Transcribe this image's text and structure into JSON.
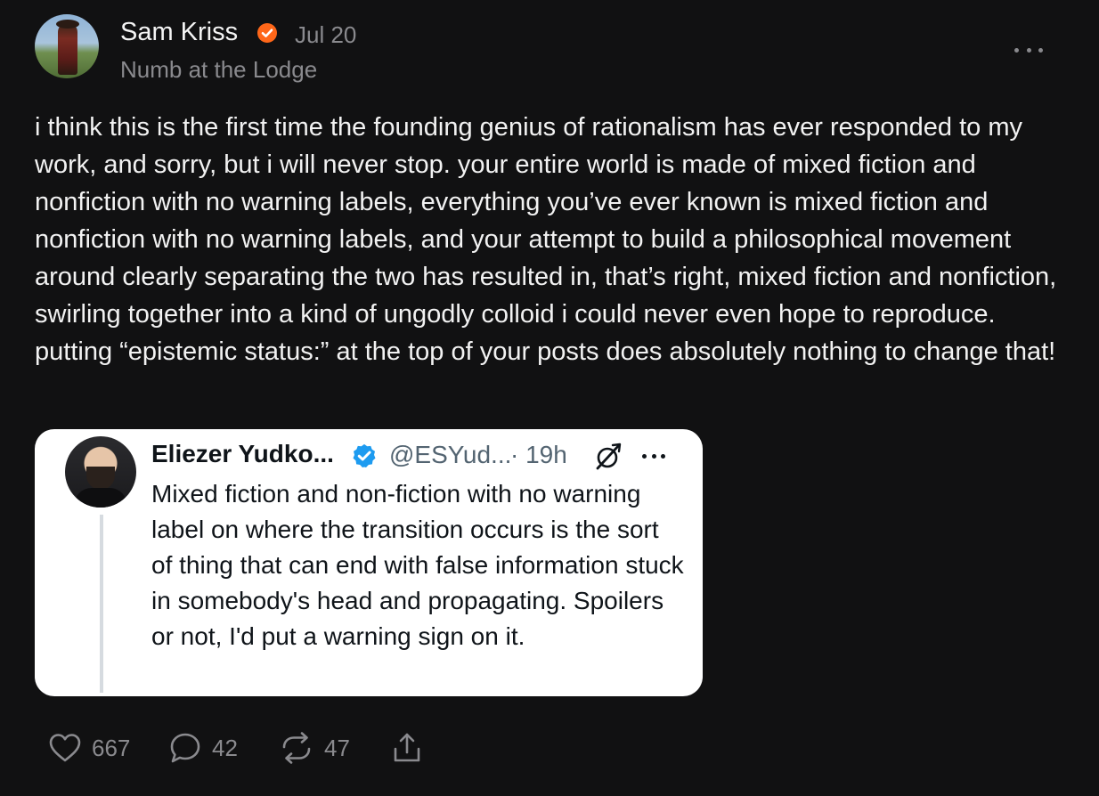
{
  "post": {
    "author": "Sam Kriss",
    "date": "Jul 20",
    "publication": "Numb at the Lodge",
    "body": "i think this is the first time the founding genius of rationalism has ever responded to my work, and sorry, but i will never stop. your entire world is made of mixed fiction and nonfiction with no warning labels, everything you’ve ever known is mixed fiction and nonfiction with no warning labels, and your attempt to build a philosophical movement around clearly separating the two has resulted in, that’s right, mixed fiction and nonfiction, swirling together into a kind of ungodly colloid i could never even hope to reproduce. putting “epistemic status:” at the top of your posts does absolutely nothing to change that!"
  },
  "quote": {
    "name": "Eliezer Yudko...",
    "handle": "@ESYud...",
    "time": "· 19h",
    "text": "Mixed fiction and non-fiction with no warning label on where the transition occurs is the sort of thing that can end with false information stuck in somebody's head and propagating. Spoilers or not, I'd put a warning sign on it."
  },
  "actions": {
    "likes": "667",
    "comments": "42",
    "restacks": "47"
  },
  "icons": {
    "verified": "verified-badge-icon",
    "more": "more-horizontal-icon",
    "like": "heart-icon",
    "comment": "comment-bubble-icon",
    "restack": "restack-arrows-icon",
    "share": "share-upload-icon",
    "grok": "grok-slash-icon"
  },
  "colors": {
    "background": "#111112",
    "text": "#f2f2f2",
    "muted": "#8a8a8e",
    "verified_orange": "#ff6719",
    "verified_blue": "#1d9bf0",
    "card": "#ffffff"
  }
}
